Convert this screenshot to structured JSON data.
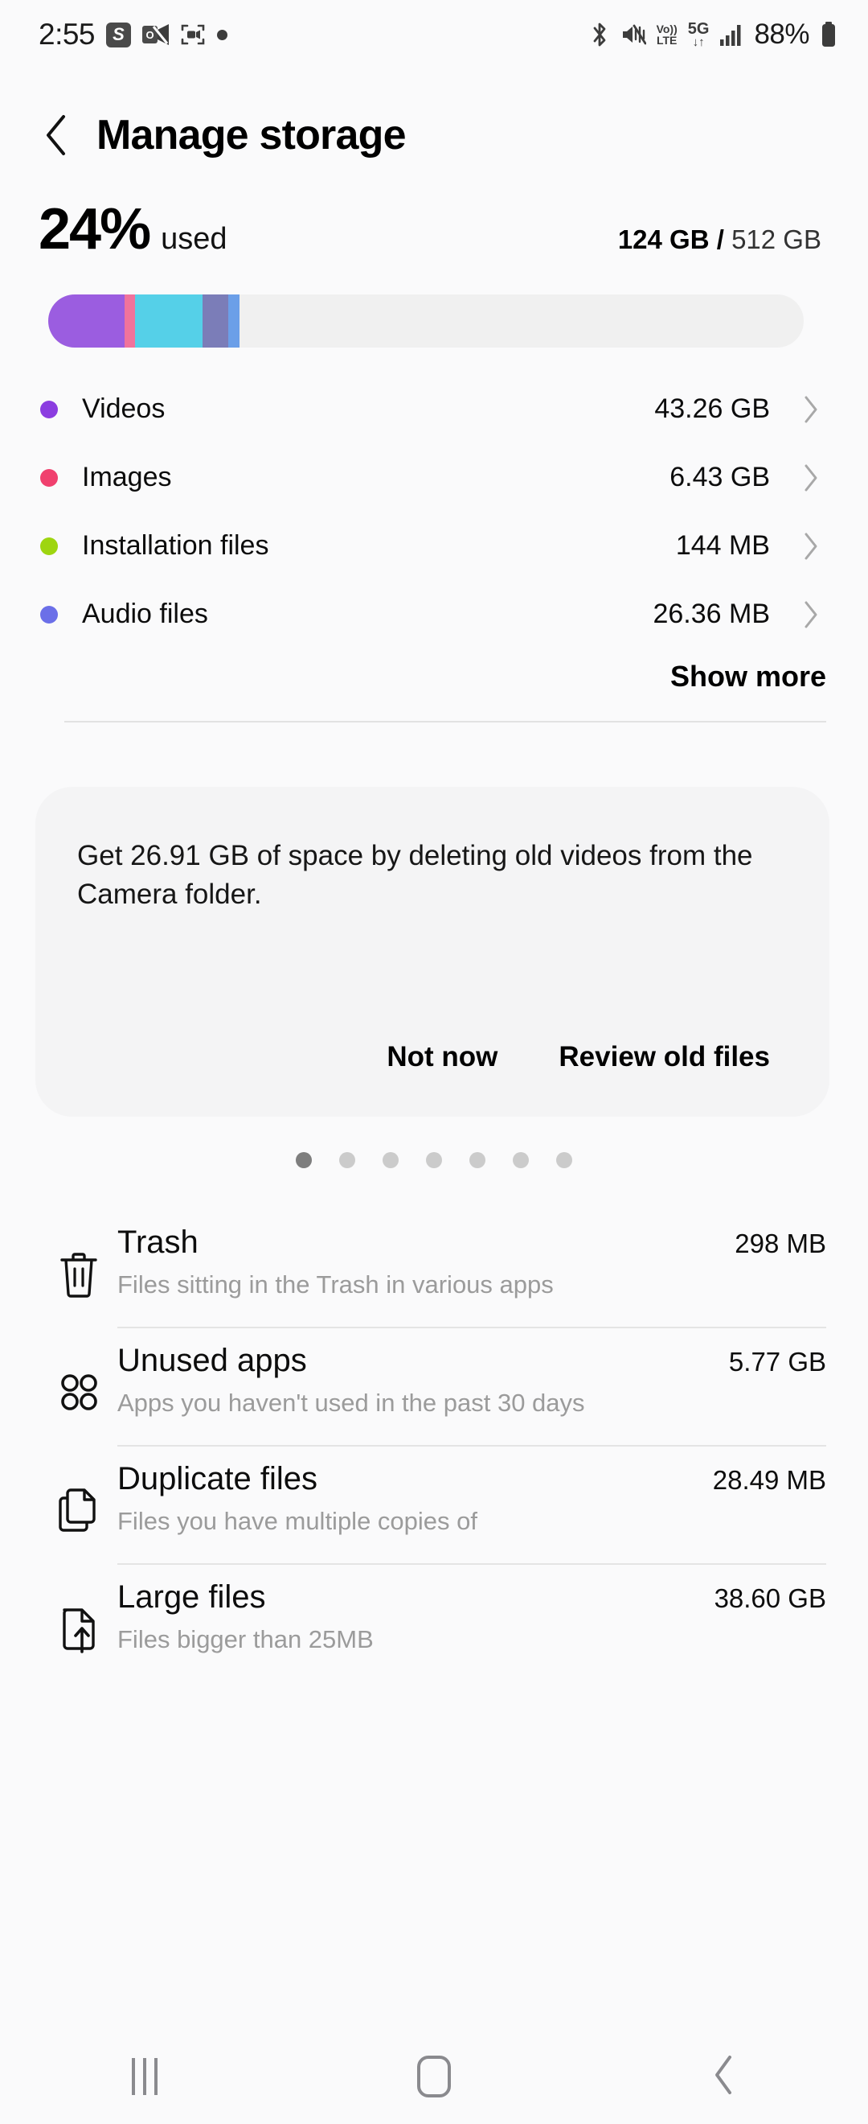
{
  "status_bar": {
    "time": "2:55",
    "left_icons": [
      "shopee-app-icon",
      "outlook-app-icon",
      "screen-record-icon",
      "recording-dot-icon"
    ],
    "shopee_letter": "S",
    "outlook_letter": "O",
    "volte_label_top": "Vo))",
    "volte_label_bottom": "LTE",
    "network_label": "5G",
    "network_arrows": "↓↑",
    "battery_percent": "88%",
    "right_icons": [
      "bluetooth-icon",
      "mute-icon",
      "volte-icon",
      "5g-icon",
      "signal-icon",
      "battery-icon"
    ]
  },
  "header": {
    "back_label": "‹",
    "title": "Manage storage"
  },
  "usage": {
    "percent": "24%",
    "used_label": "used",
    "used_size": "124 GB",
    "separator": " / ",
    "total_size": "512 GB"
  },
  "storage_bar": {
    "track_color": "#F0F0F0",
    "segments": [
      {
        "name": "videos",
        "color": "#9B5DE0",
        "width_pct": 10.1
      },
      {
        "name": "images",
        "color": "#F0739C",
        "width_pct": 1.4
      },
      {
        "name": "system",
        "color": "#55D0E8",
        "width_pct": 8.9
      },
      {
        "name": "other",
        "color": "#7B7DB8",
        "width_pct": 3.4
      },
      {
        "name": "audio",
        "color": "#6B9FE8",
        "width_pct": 1.5
      }
    ]
  },
  "categories": [
    {
      "label": "Videos",
      "value": "43.26 GB",
      "color": "#8B3DE0"
    },
    {
      "label": "Images",
      "value": "6.43 GB",
      "color": "#F0406E"
    },
    {
      "label": "Installation files",
      "value": "144 MB",
      "color": "#9ED510"
    },
    {
      "label": "Audio files",
      "value": "26.36 MB",
      "color": "#6B6FE8"
    }
  ],
  "show_more_label": "Show more",
  "suggestion_card": {
    "text": "Get 26.91 GB of space by deleting old videos from the Camera folder.",
    "dismiss_label": "Not now",
    "action_label": "Review old files"
  },
  "pager": {
    "total": 7,
    "active_index": 0
  },
  "tools": [
    {
      "title": "Trash",
      "value": "298 MB",
      "subtitle": "Files sitting in the Trash in various apps",
      "icon": "trash-icon"
    },
    {
      "title": "Unused apps",
      "value": "5.77 GB",
      "subtitle": "Apps you haven't used in the past 30 days",
      "icon": "apps-grid-icon"
    },
    {
      "title": "Duplicate files",
      "value": "28.49 MB",
      "subtitle": "Files you have multiple copies of",
      "icon": "duplicate-files-icon"
    },
    {
      "title": "Large files",
      "value": "38.60 GB",
      "subtitle": "Files bigger than 25MB",
      "icon": "large-file-icon"
    }
  ],
  "nav_bar": {
    "recents_label": "recents-icon",
    "home_label": "home-icon",
    "back_label": "back-icon"
  }
}
